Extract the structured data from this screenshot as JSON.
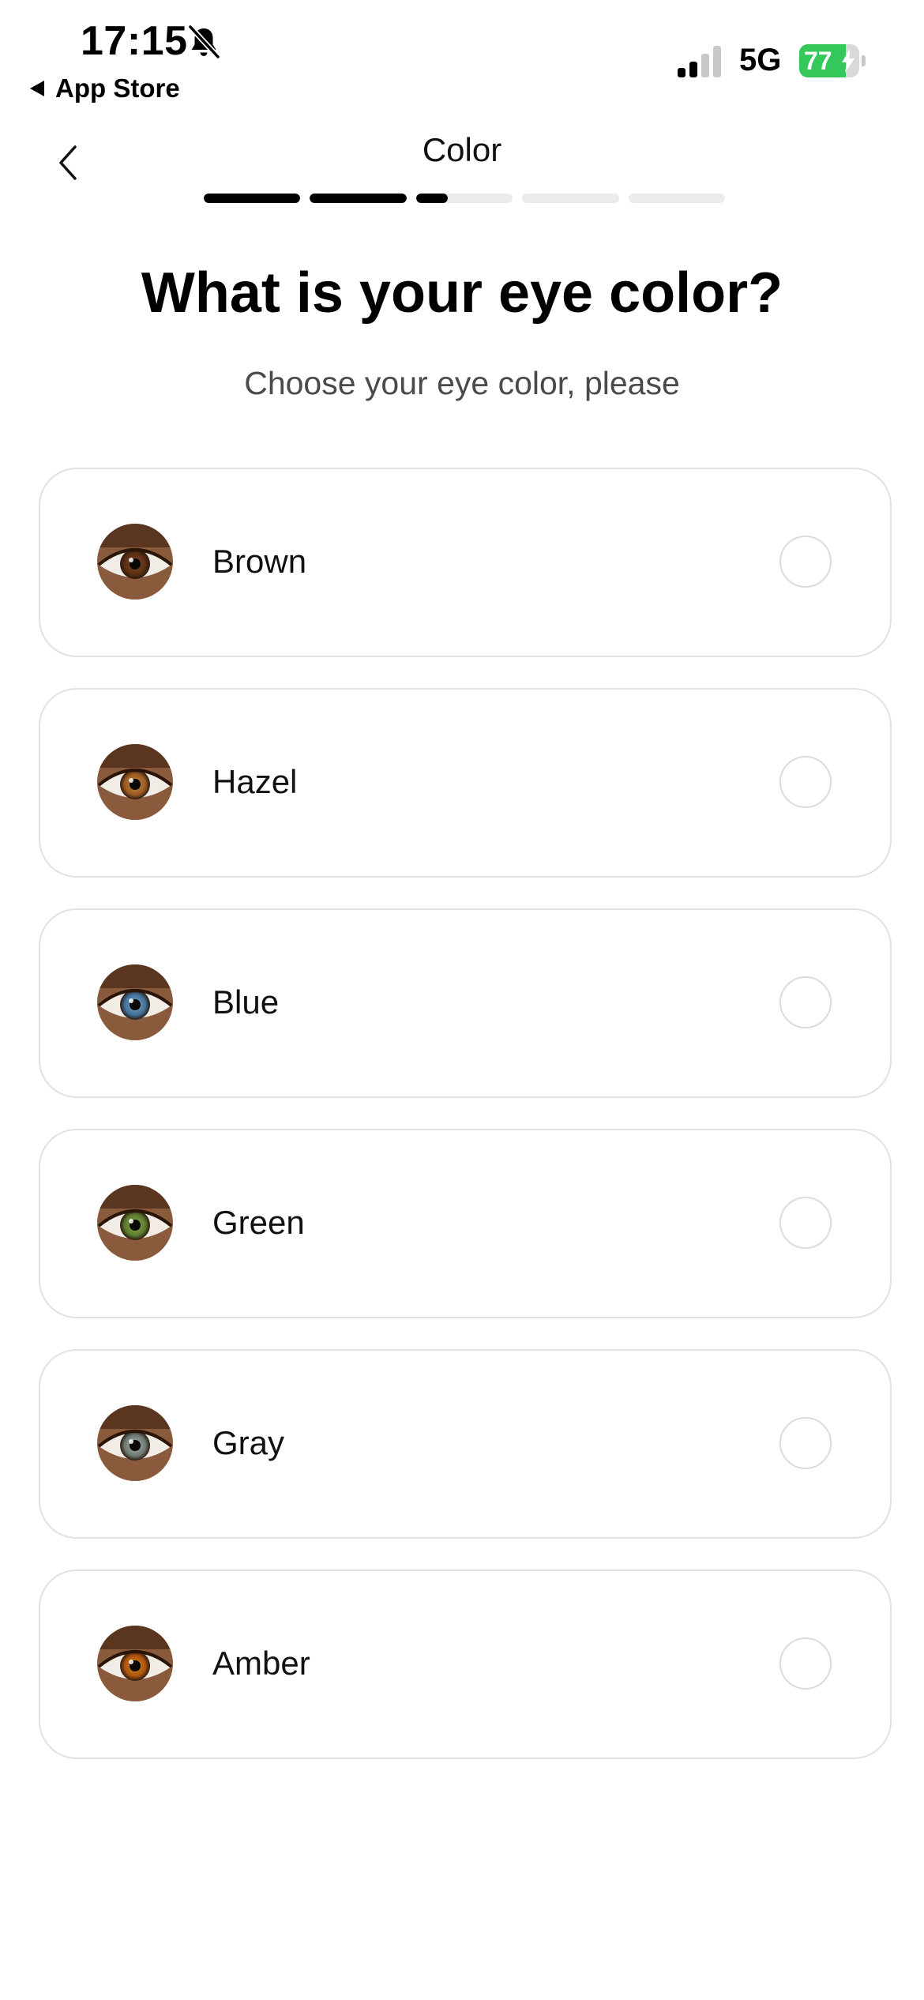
{
  "status_bar": {
    "time": "17:15",
    "back_app": "App Store",
    "network": "5G",
    "battery": "77",
    "battery_level": 0.77,
    "signal_bars_active": 2,
    "signal_bars_total": 4,
    "icons": [
      "bell-slash",
      "signal",
      "battery-charging"
    ]
  },
  "header": {
    "title": "Color",
    "back_icon": "chevron-left",
    "progress": [
      1,
      1,
      0.33,
      0,
      0
    ]
  },
  "question": {
    "title": "What is your eye color?",
    "subtitle": "Choose your eye color, please"
  },
  "options": [
    {
      "label": "Brown",
      "iris": "#5a2e14",
      "iris_inner": "#8a4a22",
      "selected": false
    },
    {
      "label": "Hazel",
      "iris": "#9a5a22",
      "iris_inner": "#c98a3a",
      "selected": false
    },
    {
      "label": "Blue",
      "iris": "#3f6f9a",
      "iris_inner": "#7fa8c8",
      "selected": false
    },
    {
      "label": "Green",
      "iris": "#5c7a2e",
      "iris_inner": "#8fae4a",
      "selected": false
    },
    {
      "label": "Gray",
      "iris": "#6e7a74",
      "iris_inner": "#a8b2ac",
      "selected": false
    },
    {
      "label": "Amber",
      "iris": "#a8520e",
      "iris_inner": "#e08a20",
      "selected": false
    }
  ],
  "colors": {
    "accent": "#000000",
    "battery_green": "#34c759",
    "card_border": "#e2e2e2",
    "progress_track": "#ebebeb"
  }
}
